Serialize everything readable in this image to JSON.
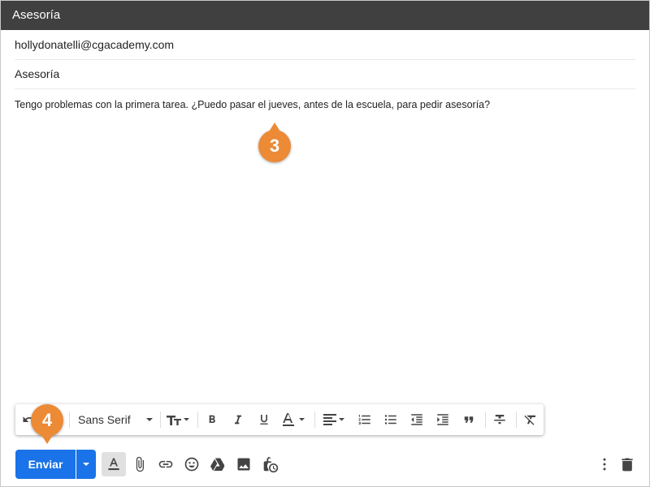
{
  "window": {
    "title": "Asesoría"
  },
  "compose": {
    "to": "hollydonatelli@cgacademy.com",
    "subject": "Asesoría",
    "body": "Tengo problemas con la primera tarea. ¿Puedo pasar el jueves, antes de la escuela, para pedir asesoría?"
  },
  "callouts": {
    "step3": "3",
    "step4": "4"
  },
  "toolbar": {
    "font_family": "Sans Serif",
    "icons": [
      "undo-icon",
      "redo-icon",
      "font-family-select",
      "font-size-icon",
      "bold-icon",
      "italic-icon",
      "underline-icon",
      "text-color-icon",
      "align-icon",
      "numbered-list-icon",
      "bulleted-list-icon",
      "indent-less-icon",
      "indent-more-icon",
      "quote-icon",
      "strikethrough-icon",
      "remove-formatting-icon"
    ]
  },
  "bottom_bar": {
    "send_label": "Enviar",
    "icons": [
      "formatting-options-icon",
      "attach-icon",
      "link-icon",
      "emoji-icon",
      "drive-icon",
      "photo-icon",
      "confidential-icon",
      "more-options-icon",
      "trash-icon"
    ]
  },
  "colors": {
    "accent": "#1a73e8",
    "title_bar": "#404040",
    "callout": "#ec8a35"
  }
}
